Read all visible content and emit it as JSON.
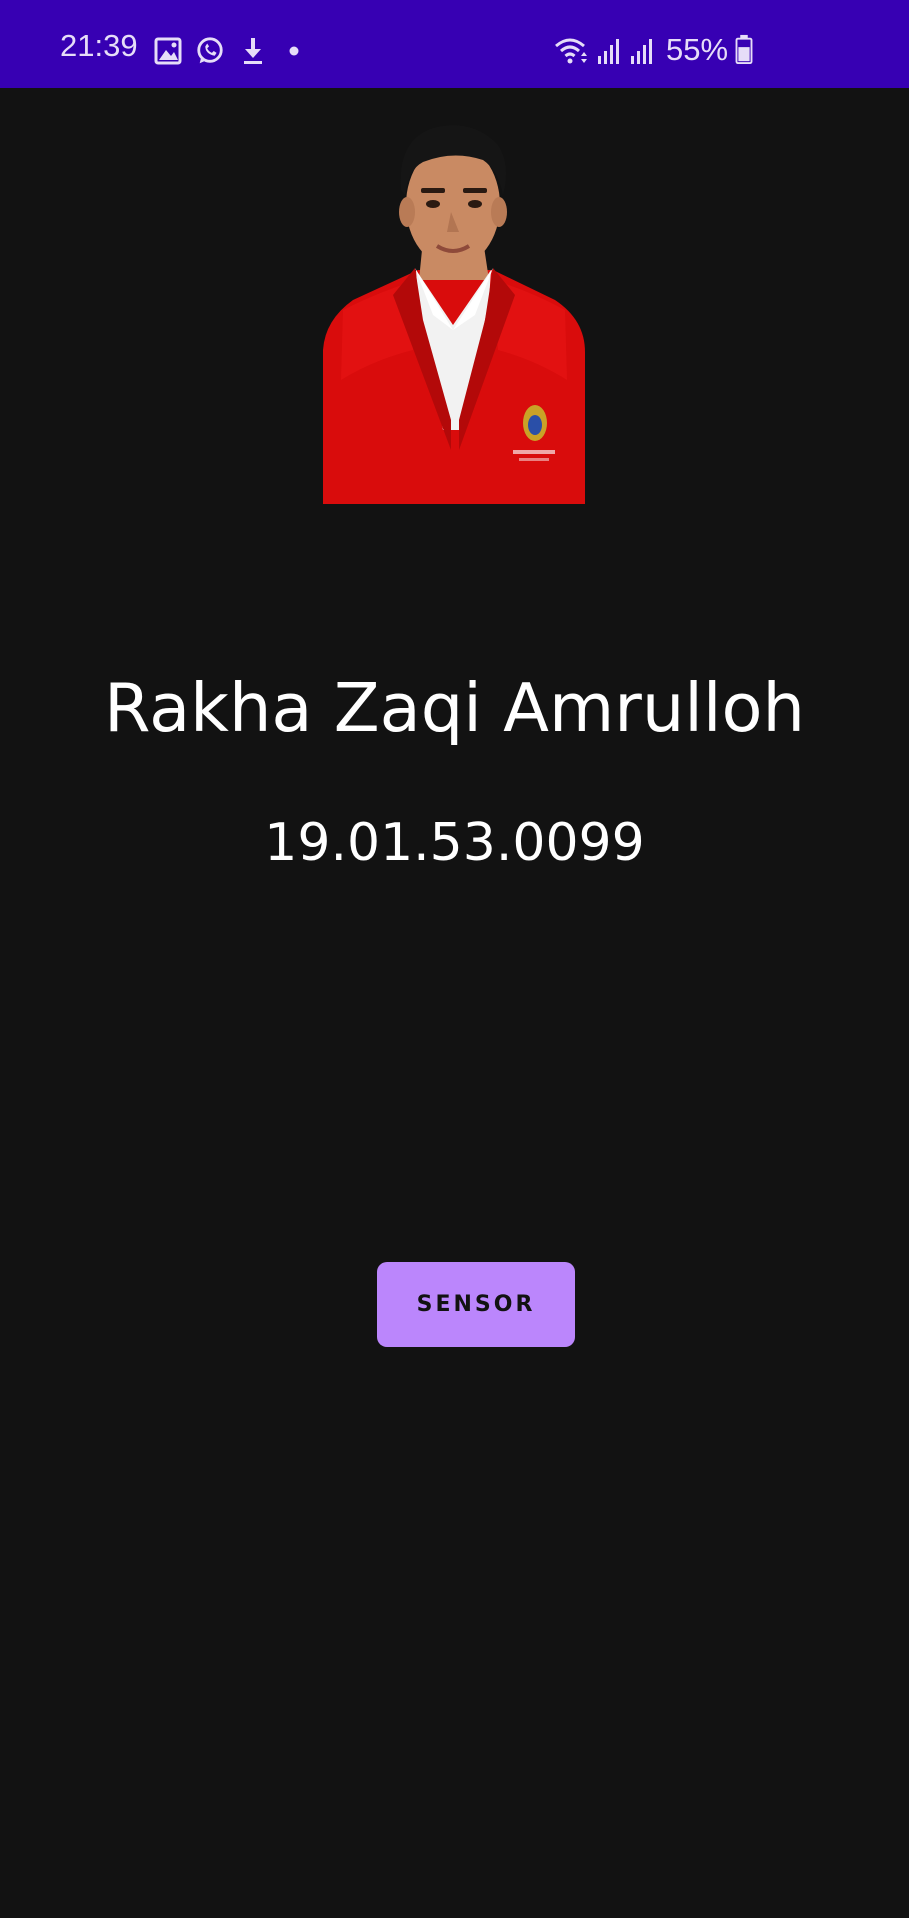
{
  "status_bar": {
    "time": "21:39",
    "battery": "55%",
    "background": "#3700B3",
    "icons": [
      "gallery-icon",
      "whatsapp-icon",
      "download-icon",
      "dot-icon",
      "wifi-icon",
      "signal-icon",
      "signal-icon",
      "battery-icon"
    ]
  },
  "profile": {
    "name": "Rakha Zaqi Amrulloh",
    "student_id": "19.01.53.0099"
  },
  "actions": {
    "sensor_label": "SENSOR",
    "accent": "#BB86FC"
  },
  "theme": {
    "background": "#121212",
    "text": "#FFFFFF"
  }
}
